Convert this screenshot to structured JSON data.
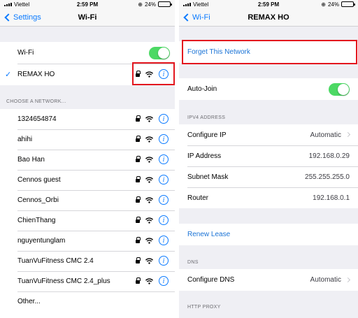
{
  "status": {
    "carrier": "Viettel",
    "time": "2:59 PM",
    "battery": "24%",
    "battery_level": 0.24
  },
  "left": {
    "back_label": "Settings",
    "title": "Wi-Fi",
    "wifi_label": "Wi-Fi",
    "wifi_on": true,
    "connected_network": "REMAX HO",
    "choose_header": "CHOOSE A NETWORK...",
    "networks": [
      "1324654874",
      "ahihi",
      "Bao Han",
      "Cennos guest",
      "Cennos_Orbi",
      "ChienThang",
      "nguyentunglam",
      "TuanVuFitness CMC 2.4",
      "TuanVuFitness CMC 2.4_plus"
    ],
    "other_label": "Other..."
  },
  "right": {
    "back_label": "Wi-Fi",
    "title": "REMAX HO",
    "forget_label": "Forget This Network",
    "auto_join_label": "Auto-Join",
    "auto_join_on": true,
    "ipv4_header": "IPV4 ADDRESS",
    "configure_ip_label": "Configure IP",
    "configure_ip_value": "Automatic",
    "ip_address_label": "IP Address",
    "ip_address_value": "192.168.0.29",
    "subnet_label": "Subnet Mask",
    "subnet_value": "255.255.255.0",
    "router_label": "Router",
    "router_value": "192.168.0.1",
    "renew_label": "Renew Lease",
    "dns_header": "DNS",
    "configure_dns_label": "Configure DNS",
    "configure_dns_value": "Automatic",
    "http_proxy_header": "HTTP PROXY"
  },
  "colors": {
    "accent": "#0a7aff",
    "toggle_on": "#4cd964",
    "highlight": "#e3161e",
    "grouped_bg": "#efeff4"
  },
  "icons": {
    "lock": "lock-icon",
    "wifi": "wifi-icon",
    "info": "info-icon",
    "check": "checkmark-icon"
  }
}
